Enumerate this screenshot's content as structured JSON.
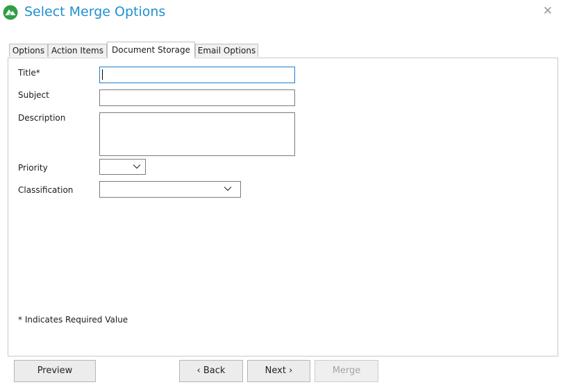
{
  "window": {
    "title": "Select Merge Options",
    "close_glyph": "✕",
    "logo_icon": "mountain-logo-icon"
  },
  "tabs": [
    {
      "label": "Options",
      "active": false
    },
    {
      "label": "Action Items",
      "active": false
    },
    {
      "label": "Document Storage",
      "active": true
    },
    {
      "label": "Email Options",
      "active": false
    }
  ],
  "form": {
    "title_label": "Title*",
    "title_value": "",
    "subject_label": "Subject",
    "subject_value": "",
    "description_label": "Description",
    "description_value": "",
    "priority_label": "Priority",
    "priority_value": "",
    "classification_label": "Classification",
    "classification_value": ""
  },
  "note": "* Indicates Required Value",
  "buttons": {
    "preview": "Preview",
    "back": "Back",
    "next": "Next",
    "merge": "Merge",
    "merge_disabled": true
  },
  "colors": {
    "title": "#1f8fd0",
    "focus_border": "#1e7ccc",
    "logo": "#2f9e44"
  }
}
